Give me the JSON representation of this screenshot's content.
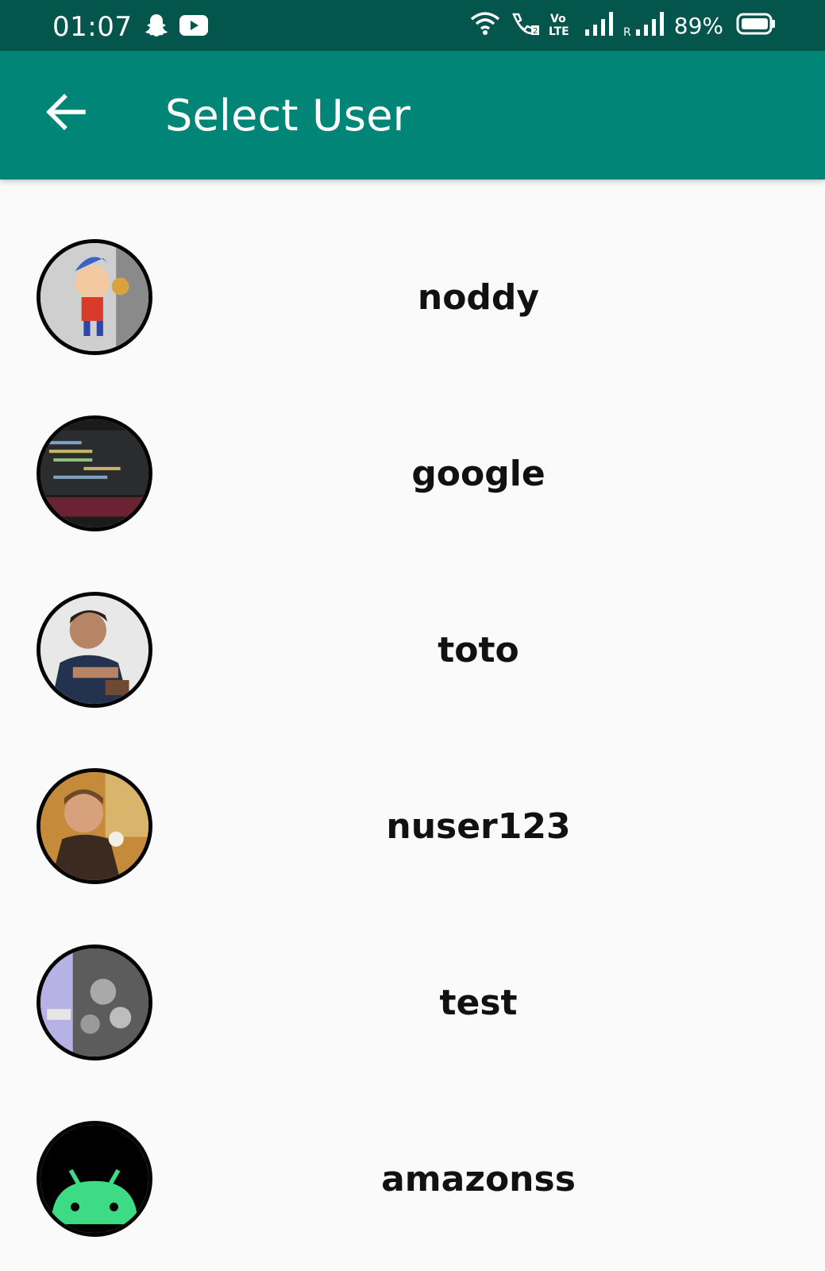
{
  "status_bar": {
    "time": "01:07",
    "battery_percent": "89%",
    "icons": [
      "snapchat-icon",
      "youtube-icon",
      "wifi-icon",
      "wifi-calling-icon",
      "volte-icon",
      "signal-icon",
      "roaming-signal-icon",
      "battery-icon"
    ]
  },
  "app_bar": {
    "title": "Select User",
    "back_icon": "arrow-left-icon"
  },
  "users": [
    {
      "name": "noddy"
    },
    {
      "name": "google"
    },
    {
      "name": "toto"
    },
    {
      "name": "nuser123"
    },
    {
      "name": "test"
    },
    {
      "name": "amazonss"
    }
  ],
  "colors": {
    "status_bar": "#04564d",
    "app_bar": "#018577",
    "background": "#fafafa",
    "android_green": "#3ddc84"
  }
}
